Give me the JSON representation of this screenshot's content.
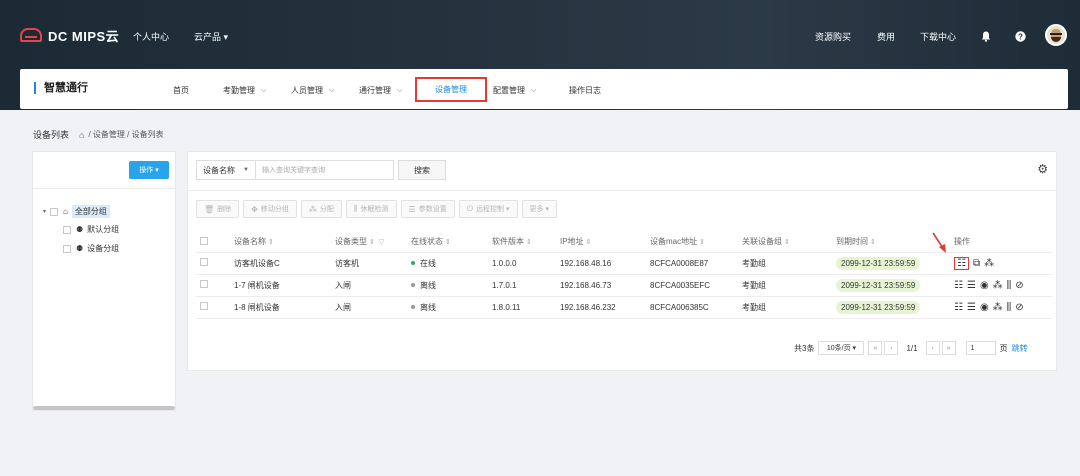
{
  "topbar": {
    "logo_text": "DC MIPS云",
    "nav": [
      "个人中心",
      "云产品 ▾"
    ],
    "right": [
      "资源购买",
      "费用",
      "下载中心"
    ],
    "icons": [
      "bell-icon",
      "help-icon",
      "avatar"
    ]
  },
  "header": {
    "brand": "智慧通行",
    "menu": [
      {
        "label": "首页",
        "has_dropdown": false
      },
      {
        "label": "考勤管理",
        "has_dropdown": true
      },
      {
        "label": "人员管理",
        "has_dropdown": true
      },
      {
        "label": "通行管理",
        "has_dropdown": true
      },
      {
        "label": "设备管理",
        "has_dropdown": false,
        "active": true
      },
      {
        "label": "配置管理",
        "has_dropdown": true
      },
      {
        "label": "操作日志",
        "has_dropdown": false
      }
    ]
  },
  "breadcrumb": {
    "title": "设备列表",
    "path": "/ 设备管理 / 设备列表"
  },
  "left_panel": {
    "op_button": "操作 ▾",
    "tree": [
      {
        "label": "全部分组",
        "selected": true
      },
      {
        "label": "默认分组"
      },
      {
        "label": "设备分组"
      }
    ]
  },
  "search": {
    "field_label": "设备名称",
    "placeholder": "输入查询关键字查询",
    "button": "搜索"
  },
  "toolbar": [
    "删除",
    "移动分组",
    "分配",
    "休眠检测",
    "参数设置",
    "远程控制 ▾",
    "更多 ▾"
  ],
  "table": {
    "headers": [
      "设备名称",
      "设备类型",
      "在线状态",
      "软件版本",
      "IP地址",
      "设备mac地址",
      "关联设备组",
      "到期时间",
      "操作"
    ],
    "rows": [
      {
        "name": "访客机设备C",
        "type": "访客机",
        "status": "在线",
        "online": true,
        "version": "1.0.0.0",
        "ip": "192.168.48.16",
        "mac": "8CFCA0008E87",
        "group": "考勤组",
        "expire": "2099-12-31 23:59:59"
      },
      {
        "name": "1-7 闸机设备",
        "type": "入闸",
        "status": "离线",
        "online": false,
        "version": "1.7.0.1",
        "ip": "192.168.46.73",
        "mac": "8CFCA0035EFC",
        "group": "考勤组",
        "expire": "2099-12-31 23:59:59"
      },
      {
        "name": "1-8 闸机设备",
        "type": "入闸",
        "status": "离线",
        "online": false,
        "version": "1.8.0.11",
        "ip": "192.168.46.232",
        "mac": "8CFCA006385C",
        "group": "考勤组",
        "expire": "2099-12-31 23:59:59"
      }
    ]
  },
  "pager": {
    "total": "共3条",
    "page_size": "10条/页 ▾",
    "page_info": "1/1",
    "page_input": "1",
    "unit": "页",
    "go": "跳转"
  },
  "colors": {
    "accent": "#1e88e5",
    "op_button": "#29a3e9",
    "highlight": "#e53935",
    "online": "#27ae60"
  }
}
